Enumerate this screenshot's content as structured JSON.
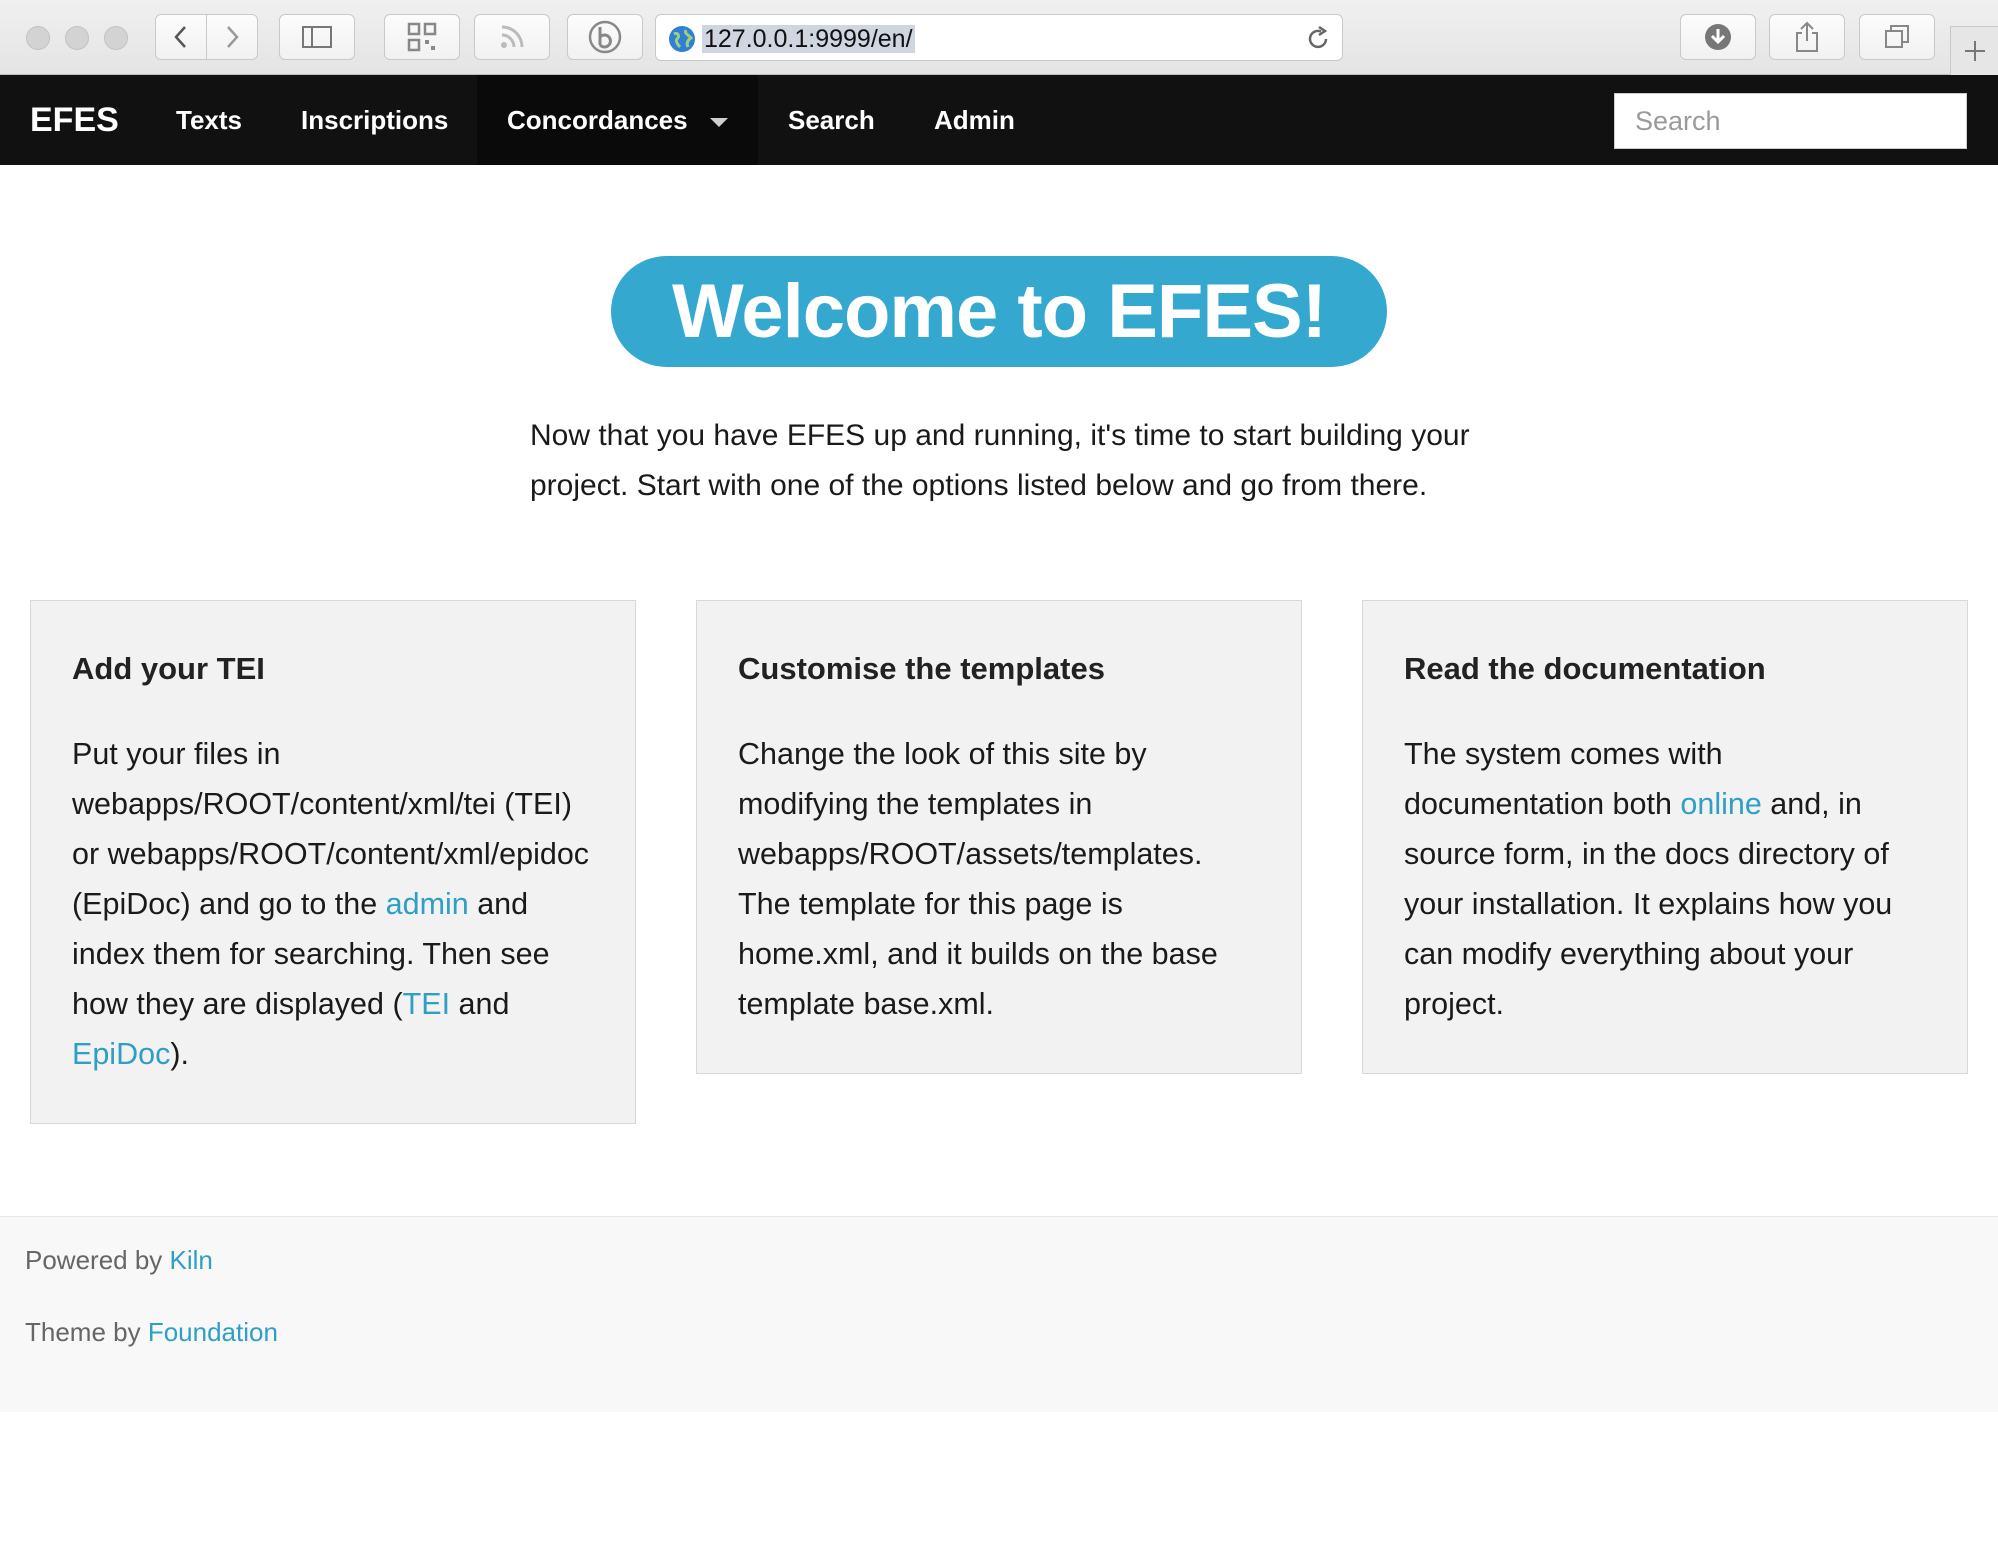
{
  "browser": {
    "url": "127.0.0.1:9999/en/",
    "icons": [
      "back-icon",
      "forward-icon",
      "sidebar-icon",
      "qr-code-icon",
      "rss-icon",
      "bookmark-b-icon",
      "globe-icon",
      "reload-icon",
      "download-icon",
      "share-icon",
      "tabs-icon",
      "new-tab-icon"
    ]
  },
  "topbar": {
    "brand": "EFES",
    "nav": [
      "Texts",
      "Inscriptions",
      "Concordances",
      "Search",
      "Admin"
    ],
    "search_placeholder": "Search"
  },
  "hero": {
    "title": "Welcome to EFES!",
    "intro": "Now that you have EFES up and running, it's time to start building your project. Start with one of the options listed below and go from there."
  },
  "panels": [
    {
      "title": "Add your TEI",
      "t1": "Put your files in webapps/ROOT/content/xml/tei (TEI) or webapps/ROOT/content/xml/epidoc (EpiDoc) and go to the ",
      "l1": "admin",
      "t2": " and index them for searching. Then see how they are displayed (",
      "l2": "TEI",
      "t3": " and ",
      "l3": "EpiDoc",
      "t4": ")."
    },
    {
      "title": "Customise the templates",
      "text": "Change the look of this site by modifying the templates in webapps/ROOT/assets/templates. The template for this page is home.xml, and it builds on the base template base.xml."
    },
    {
      "title": "Read the documentation",
      "t1": "The system comes with documentation both ",
      "l1": "online",
      "t2": " and, in source form, in the docs directory of your installation. It explains how you can modify everything about your project."
    }
  ],
  "footer": {
    "powered_prefix": "Powered by ",
    "powered_link": "Kiln",
    "theme_prefix": "Theme by ",
    "theme_link": "Foundation"
  },
  "colors": {
    "accent": "#35a8cf",
    "link": "#2f9fc6",
    "topbar": "#111111",
    "panel": "#f2f2f2"
  }
}
